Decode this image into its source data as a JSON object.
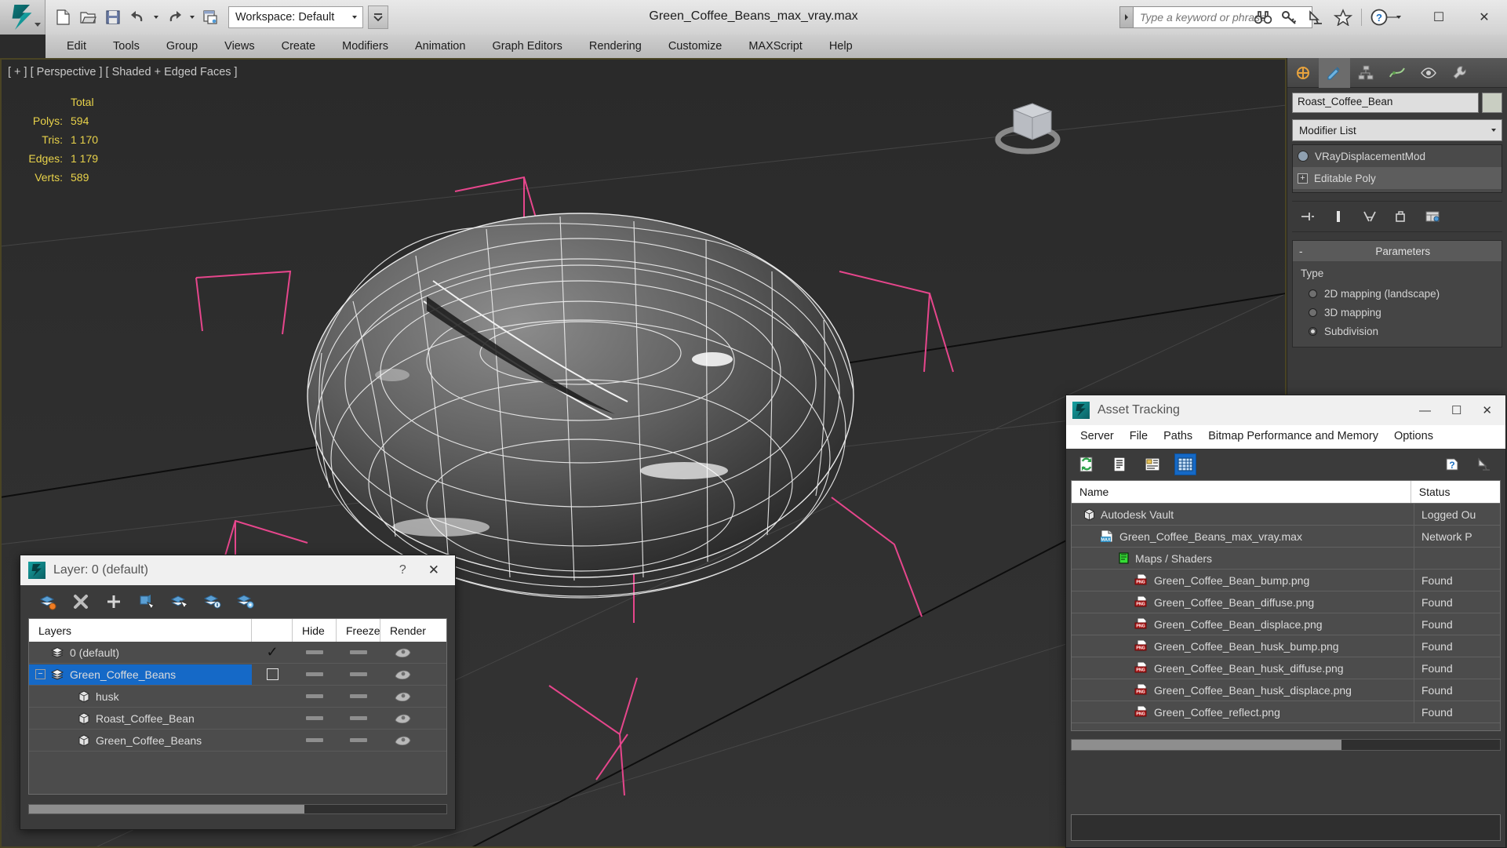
{
  "app": {
    "window_title": "Green_Coffee_Beans_max_vray.max",
    "logo": "autodesk-3dsmax-logo"
  },
  "quick_access": {
    "items": [
      {
        "name": "new-file-icon",
        "label": "New"
      },
      {
        "name": "open-file-icon",
        "label": "Open"
      },
      {
        "name": "save-file-icon",
        "label": "Save"
      },
      {
        "name": "undo-icon",
        "label": "Undo"
      },
      {
        "name": "redo-icon",
        "label": "Redo"
      },
      {
        "name": "project-folder-icon",
        "label": "Set Project Folder"
      }
    ],
    "workspace_label": "Workspace: Default"
  },
  "search": {
    "placeholder": "Type a keyword or phrase",
    "value": ""
  },
  "titlebar_icons": [
    {
      "name": "binoculars-icon",
      "label": "Search"
    },
    {
      "name": "key-icon",
      "label": "Sign In"
    },
    {
      "name": "satellite-dish-icon",
      "label": "Autodesk 360"
    },
    {
      "name": "star-icon",
      "label": "Favorites"
    },
    {
      "name": "help-icon",
      "label": "Help"
    }
  ],
  "window_controls": {
    "minimize": "—",
    "maximize": "☐",
    "close": "✕"
  },
  "menubar": {
    "items": [
      "Edit",
      "Tools",
      "Group",
      "Views",
      "Create",
      "Modifiers",
      "Animation",
      "Graph Editors",
      "Rendering",
      "Customize",
      "MAXScript",
      "Help"
    ]
  },
  "viewport": {
    "label": "[ + ] [ Perspective ] [ Shaded + Edged Faces ]",
    "stats": {
      "header": "Total",
      "rows": [
        {
          "label": "Polys:",
          "value": "594"
        },
        {
          "label": "Tris:",
          "value": "1 170"
        },
        {
          "label": "Edges:",
          "value": "1 179"
        },
        {
          "label": "Verts:",
          "value": "589"
        }
      ]
    }
  },
  "command_panel": {
    "tabs": [
      {
        "name": "create-tab",
        "label": "Create"
      },
      {
        "name": "modify-tab",
        "label": "Modify"
      },
      {
        "name": "hierarchy-tab",
        "label": "Hierarchy"
      },
      {
        "name": "motion-tab",
        "label": "Motion"
      },
      {
        "name": "display-tab",
        "label": "Display"
      },
      {
        "name": "utilities-tab",
        "label": "Utilities"
      }
    ],
    "object_name": "Roast_Coffee_Bean",
    "object_color": "#c9cec2",
    "modifier_list_label": "Modifier List",
    "stack": [
      {
        "label": "VRayDisplacementMod",
        "selected": false
      },
      {
        "label": "Editable Poly",
        "selected": true
      }
    ],
    "stack_tools": [
      {
        "name": "pin-stack-icon"
      },
      {
        "name": "show-end-result-icon"
      },
      {
        "name": "make-unique-icon"
      },
      {
        "name": "remove-modifier-icon"
      },
      {
        "name": "configure-modifier-sets-icon"
      }
    ],
    "rollout": {
      "title": "Parameters",
      "collapse_glyph": "-",
      "type_label": "Type",
      "options": [
        {
          "label": "2D mapping (landscape)",
          "selected": false
        },
        {
          "label": "3D mapping",
          "selected": false
        },
        {
          "label": "Subdivision",
          "selected": true
        }
      ]
    }
  },
  "layer_dialog": {
    "title": "Layer: 0 (default)",
    "help_glyph": "?",
    "close_glyph": "✕",
    "toolbar": [
      {
        "name": "create-new-layer-icon"
      },
      {
        "name": "delete-layer-icon"
      },
      {
        "name": "add-selection-to-layer-icon"
      },
      {
        "name": "select-objects-in-layer-icon"
      },
      {
        "name": "select-highlighted-layers-icon"
      },
      {
        "name": "highlight-selected-objects-layer-icon"
      },
      {
        "name": "layer-properties-icon"
      }
    ],
    "columns": [
      "Layers",
      "",
      "Hide",
      "Freeze",
      "Render"
    ],
    "rows": [
      {
        "name": "0 (default)",
        "indent": 0,
        "type": "layer",
        "expander": "",
        "current": "✓",
        "hide": "dash",
        "freeze": "dash",
        "render": "icon"
      },
      {
        "name": "Green_Coffee_Beans",
        "indent": 0,
        "type": "layer",
        "expander": "−",
        "current": "box",
        "hide": "dash",
        "freeze": "dash",
        "render": "icon",
        "selected": true
      },
      {
        "name": "husk",
        "indent": 1,
        "type": "object",
        "expander": "",
        "current": "",
        "hide": "dash",
        "freeze": "dash",
        "render": "icon"
      },
      {
        "name": "Roast_Coffee_Bean",
        "indent": 1,
        "type": "object",
        "expander": "",
        "current": "",
        "hide": "dash",
        "freeze": "dash",
        "render": "icon"
      },
      {
        "name": "Green_Coffee_Beans",
        "indent": 1,
        "type": "object",
        "expander": "",
        "current": "",
        "hide": "dash",
        "freeze": "dash",
        "render": "icon"
      }
    ]
  },
  "asset_tracking": {
    "title": "Asset Tracking",
    "window_controls": {
      "minimize": "—",
      "maximize": "☐",
      "close": "✕"
    },
    "menus": [
      "Server",
      "File",
      "Paths",
      "Bitmap Performance and Memory",
      "Options"
    ],
    "toolbar": [
      {
        "name": "refresh-icon",
        "active": false
      },
      {
        "name": "list-view-icon",
        "active": false
      },
      {
        "name": "detail-view-icon",
        "active": false
      },
      {
        "name": "grid-view-icon",
        "active": true
      }
    ],
    "toolbar_right": [
      {
        "name": "help-icon",
        "active": false
      },
      {
        "name": "satellite-icon",
        "active": false
      }
    ],
    "columns": [
      "Name",
      "Status"
    ],
    "rows": [
      {
        "name": "Autodesk Vault",
        "status": "Logged Ou",
        "icon": "cube-icon",
        "indent": 0
      },
      {
        "name": "Green_Coffee_Beans_max_vray.max",
        "status": "Network P",
        "icon": "max-file-icon",
        "indent": 1
      },
      {
        "name": "Maps / Shaders",
        "status": "",
        "icon": "maps-icon",
        "indent": 2
      },
      {
        "name": "Green_Coffee_Bean_bump.png",
        "status": "Found",
        "icon": "png-file-icon",
        "indent": 3
      },
      {
        "name": "Green_Coffee_Bean_diffuse.png",
        "status": "Found",
        "icon": "png-file-icon",
        "indent": 3
      },
      {
        "name": "Green_Coffee_Bean_displace.png",
        "status": "Found",
        "icon": "png-file-icon",
        "indent": 3
      },
      {
        "name": "Green_Coffee_Bean_husk_bump.png",
        "status": "Found",
        "icon": "png-file-icon",
        "indent": 3
      },
      {
        "name": "Green_Coffee_Bean_husk_diffuse.png",
        "status": "Found",
        "icon": "png-file-icon",
        "indent": 3
      },
      {
        "name": "Green_Coffee_Bean_husk_displace.png",
        "status": "Found",
        "icon": "png-file-icon",
        "indent": 3
      },
      {
        "name": "Green_Coffee_reflect.png",
        "status": "Found",
        "icon": "png-file-icon",
        "indent": 3
      }
    ]
  },
  "colors": {
    "accent_blue": "#1569c7",
    "viewport_bg": "#2e2e2e",
    "stats_yellow": "#e8d24a",
    "gizmo_pink": "#e6468c"
  }
}
